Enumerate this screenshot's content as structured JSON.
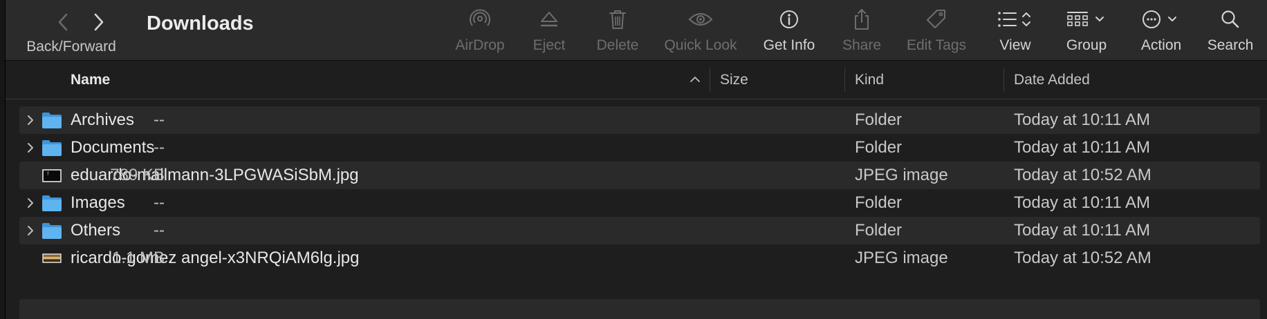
{
  "window": {
    "title": "Downloads"
  },
  "toolbar": {
    "nav_caption": "Back/Forward",
    "items": [
      {
        "label": "AirDrop",
        "icon": "airdrop-icon",
        "enabled": false
      },
      {
        "label": "Eject",
        "icon": "eject-icon",
        "enabled": false
      },
      {
        "label": "Delete",
        "icon": "trash-icon",
        "enabled": false
      },
      {
        "label": "Quick Look",
        "icon": "eye-icon",
        "enabled": false
      },
      {
        "label": "Get Info",
        "icon": "info-icon",
        "enabled": true
      },
      {
        "label": "Share",
        "icon": "share-icon",
        "enabled": false
      },
      {
        "label": "Edit Tags",
        "icon": "tag-icon",
        "enabled": false
      },
      {
        "label": "View",
        "icon": "list-view-icon",
        "enabled": true
      },
      {
        "label": "Group",
        "icon": "group-icon",
        "enabled": true
      },
      {
        "label": "Action",
        "icon": "ellipsis-circle-icon",
        "enabled": true
      },
      {
        "label": "Search",
        "icon": "magnifier-icon",
        "enabled": true
      }
    ]
  },
  "columns": {
    "name": "Name",
    "size": "Size",
    "kind": "Kind",
    "date_added": "Date Added"
  },
  "files": [
    {
      "name": "Archives",
      "size": "--",
      "kind": "Folder",
      "date": "Today at 10:11 AM",
      "type": "folder"
    },
    {
      "name": "Documents",
      "size": "--",
      "kind": "Folder",
      "date": "Today at 10:11 AM",
      "type": "folder"
    },
    {
      "name": "eduardo-mallmann-3LPGWASiSbM.jpg",
      "size": "789 KB",
      "kind": "JPEG image",
      "date": "Today at 10:52 AM",
      "type": "image"
    },
    {
      "name": "Images",
      "size": "--",
      "kind": "Folder",
      "date": "Today at 10:11 AM",
      "type": "folder"
    },
    {
      "name": "Others",
      "size": "--",
      "kind": "Folder",
      "date": "Today at 10:11 AM",
      "type": "folder"
    },
    {
      "name": "ricardo-gomez angel-x3NRQiAM6lg.jpg",
      "size": "1.1 MB",
      "kind": "JPEG image",
      "date": "Today at 10:52 AM",
      "type": "image-landscape"
    }
  ],
  "colors": {
    "folder_blue": "#5fb4f0",
    "toolbar_bg": "#2b2b2b",
    "window_bg": "#1e1e1e",
    "alt_row": "#2a2a2a"
  }
}
